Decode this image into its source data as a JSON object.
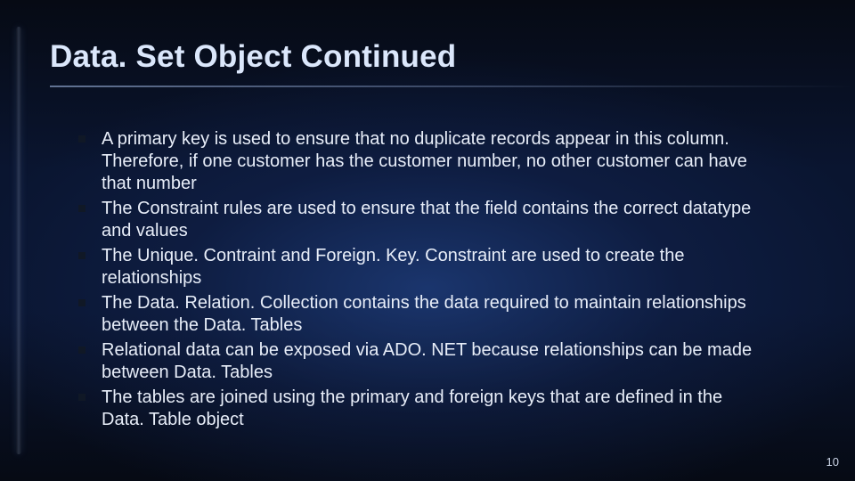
{
  "title": "Data. Set Object Continued",
  "bullets": [
    "A primary key is used to ensure that no duplicate records appear in this column. Therefore, if one customer has the customer number, no other customer can have that number",
    "The Constraint rules are used to ensure that the field contains the correct datatype and values",
    "The Unique. Contraint and Foreign. Key. Constraint are used to create the relationships",
    "The Data. Relation. Collection contains the data required to maintain relationships between the Data. Tables",
    "Relational data can be exposed via ADO. NET because relationships can be made between Data. Tables",
    "The tables are joined using the primary and foreign keys that are defined in the Data. Table object"
  ],
  "page_number": "10"
}
